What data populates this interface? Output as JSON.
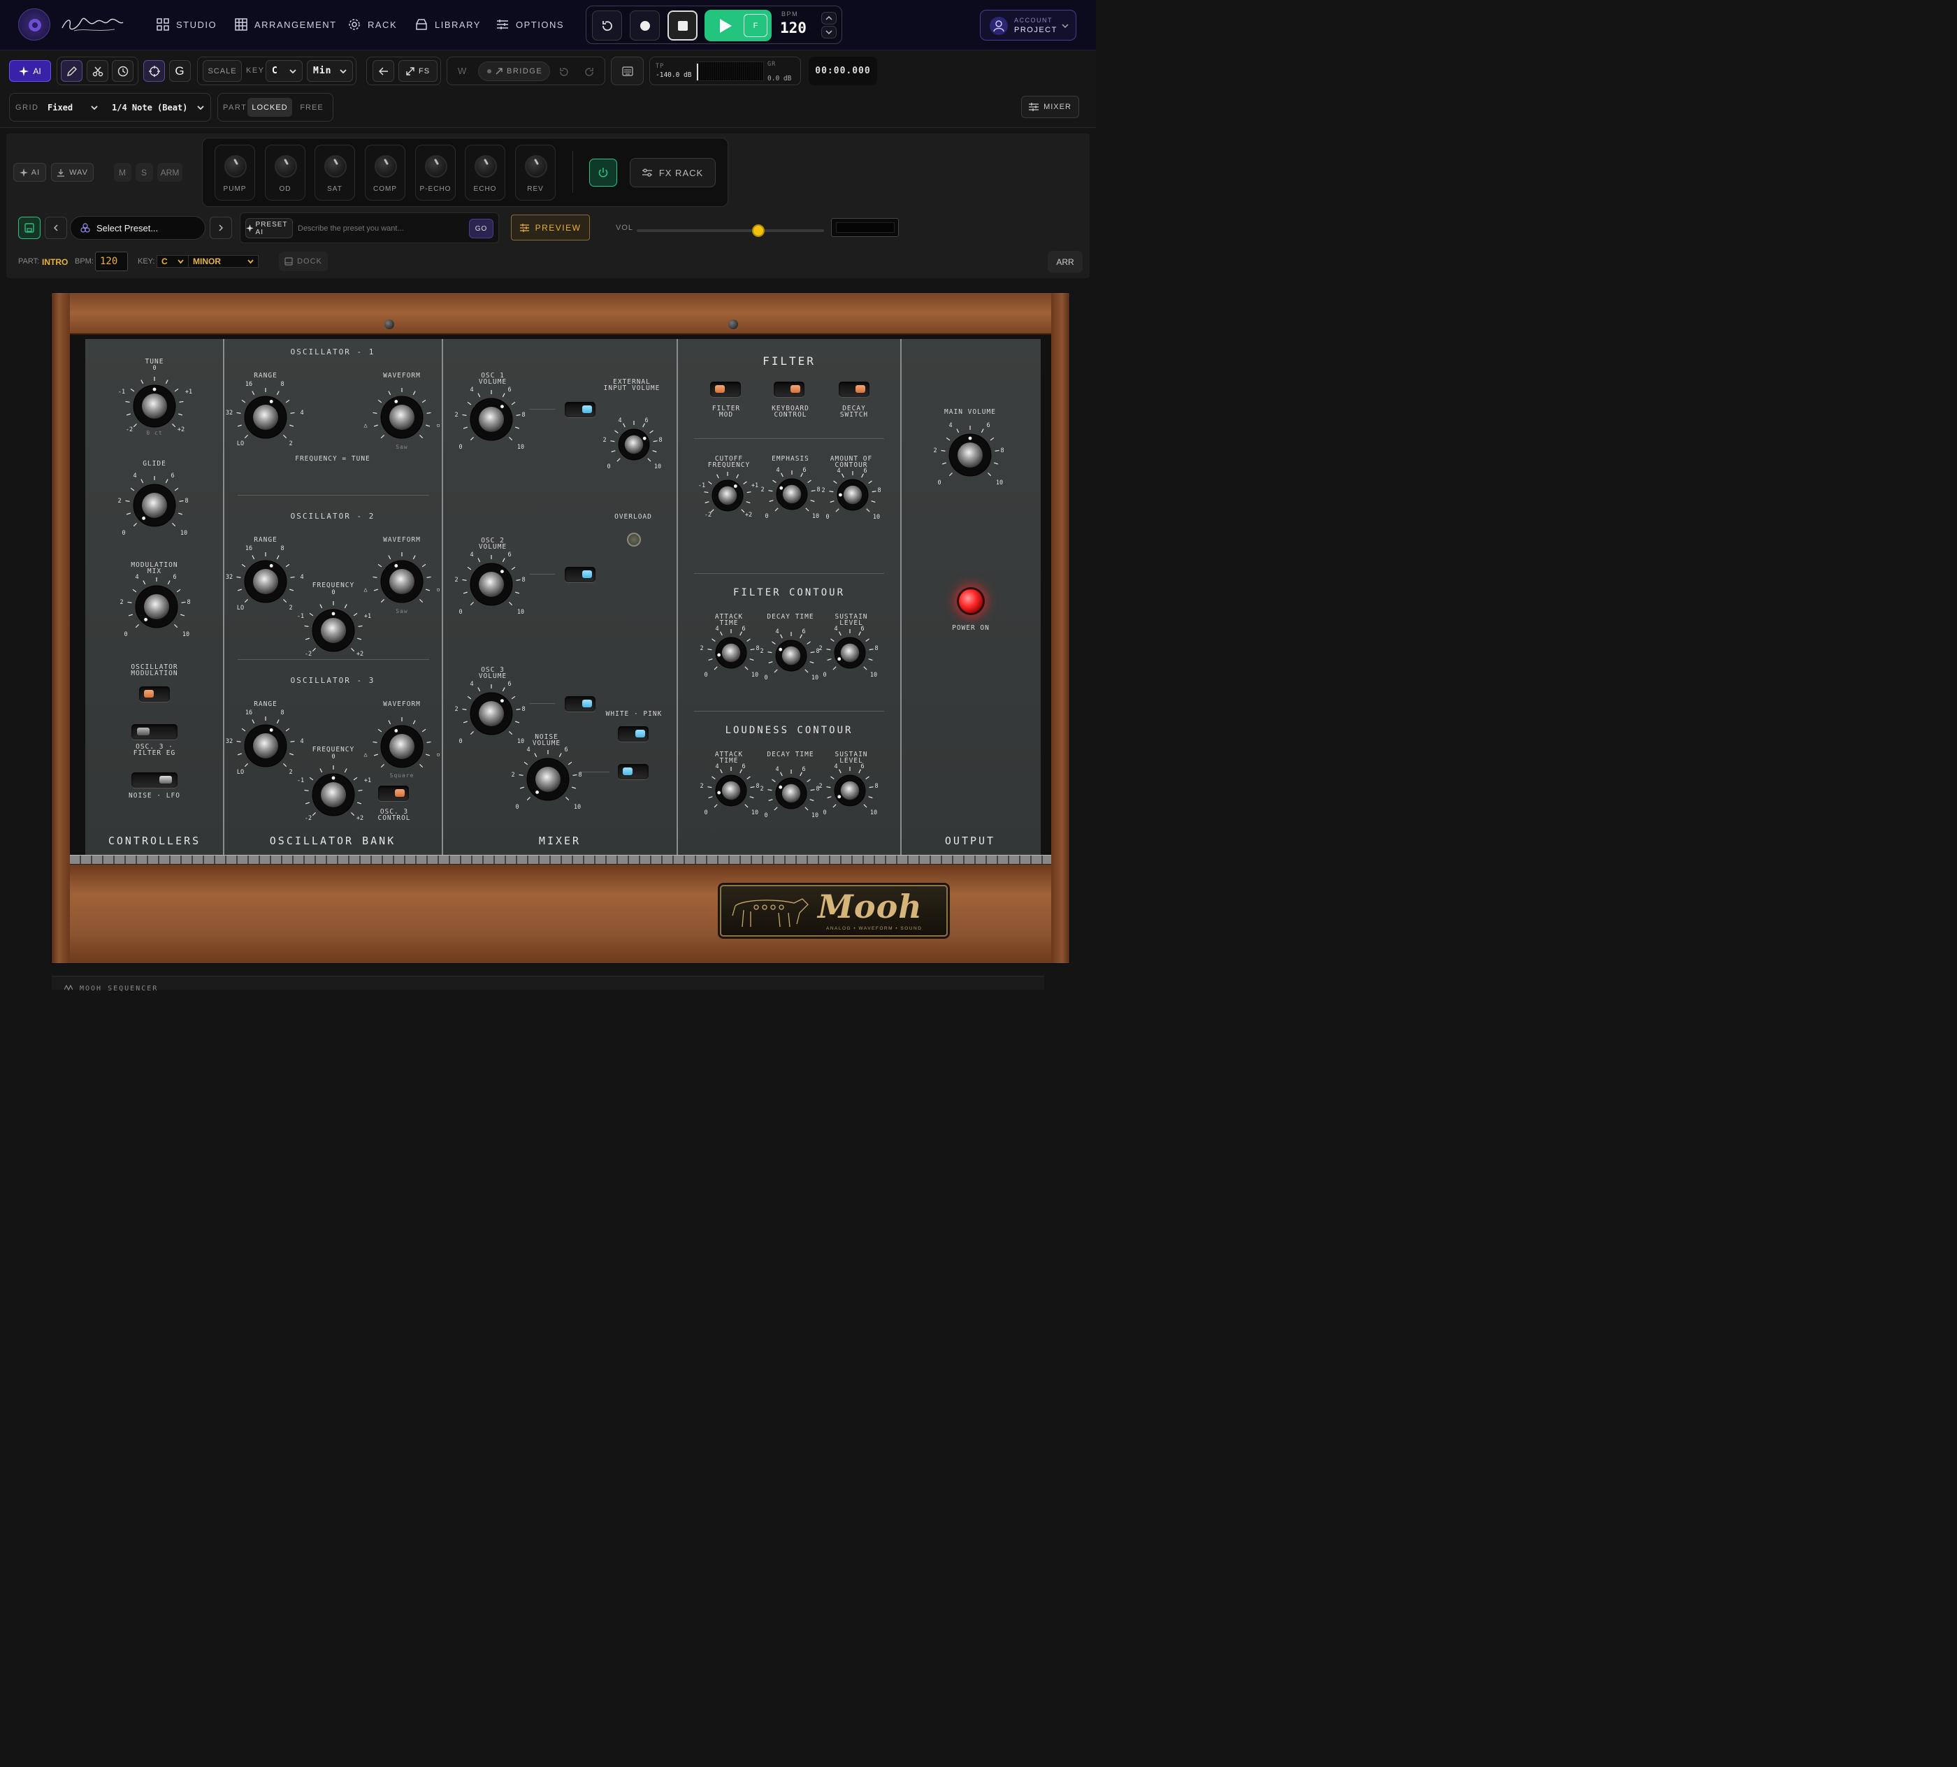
{
  "nav": {
    "tabs": [
      {
        "label": "STUDIO",
        "icon": "grid-icon"
      },
      {
        "label": "ARRANGEMENT",
        "icon": "table-icon"
      },
      {
        "label": "RACK",
        "icon": "gear-icon"
      },
      {
        "label": "LIBRARY",
        "icon": "box-icon"
      },
      {
        "label": "OPTIONS",
        "icon": "sliders-icon"
      }
    ],
    "transport": {
      "follow": "F",
      "bpm_label": "BPM",
      "bpm": "120"
    },
    "account": {
      "label": "ACCOUNT",
      "project": "PROJECT"
    }
  },
  "toolbar": {
    "ai": "AI",
    "g": "G",
    "scale": "SCALE",
    "key_label": "KEY",
    "key": "C",
    "mode": "Min",
    "fs": "FS",
    "w": "W",
    "bridge": "BRIDGE",
    "tp_label": "TP",
    "tp_value": "-140.0 dB",
    "gr_label": "GR",
    "gr_value": "0.0 dB",
    "time": "00:00.000"
  },
  "grid_row": {
    "grid_label": "GRID",
    "grid_value": "Fixed",
    "note_value": "1/4 Note (Beat)",
    "part_label": "PART",
    "locked": "LOCKED",
    "free": "FREE",
    "mixer": "MIXER"
  },
  "track": {
    "ai": "AI",
    "wav": "WAV",
    "m": "M",
    "s": "S",
    "arm": "ARM",
    "fx": [
      "PUMP",
      "OD",
      "SAT",
      "COMP",
      "P-ECHO",
      "ECHO",
      "REV"
    ],
    "fx_rack": "FX RACK",
    "preset_placeholder": "Select Preset...",
    "preset_ai": "PRESET AI",
    "prompt_placeholder": "Describe the preset you want...",
    "go": "GO",
    "preview": "PREVIEW",
    "vol": "VOL",
    "vol_level": 0.65,
    "part_label": "PART:",
    "part_value": "INTRO",
    "bpm_label": "BPM:",
    "bpm_value": "120",
    "key_label": "KEY:",
    "key_value": "C",
    "mode_value": "MINOR",
    "dock": "DOCK",
    "arr": "ARR"
  },
  "synth": {
    "controllers": {
      "title": "CONTROLLERS",
      "tune": "TUNE",
      "glide": "GLIDE",
      "mod_mix": "MODULATION MIX",
      "osc_mod": "OSCILLATOR MODULATION",
      "osc3_filter": "OSC. 3 · FILTER EG",
      "noise_lfo": "NOISE · LFO",
      "ct": "0 ct"
    },
    "osc": {
      "title": "OSCILLATOR BANK",
      "osc1": "OSCILLATOR - 1",
      "osc2": "OSCILLATOR - 2",
      "osc3": "OSCILLATOR - 3",
      "range": "RANGE",
      "waveform": "WAVEFORM",
      "freq_tune": "FREQUENCY = TUNE",
      "frequency": "FREQUENCY",
      "saw": "Saw",
      "square": "Square",
      "osc3_ctrl": "OSC. 3 CONTROL"
    },
    "mixer": {
      "title": "MIXER",
      "osc1_vol": "OSC 1 VOLUME",
      "osc2_vol": "OSC 2 VOLUME",
      "osc3_vol": "OSC 3 VOLUME",
      "ext": "EXTERNAL INPUT VOLUME",
      "overload": "OVERLOAD",
      "white_pink": "WHITE · PINK",
      "noise_vol": "NOISE VOLUME"
    },
    "filter": {
      "title": "FILTER",
      "filter_mod": "FILTER MOD",
      "kbd": "KEYBOARD CONTROL",
      "decay_sw": "DECAY SWITCH",
      "cutoff": "CUTOFF FREQUENCY",
      "emphasis": "EMPHASIS",
      "amount": "AMOUNT OF CONTOUR",
      "fc_title": "FILTER CONTOUR",
      "lc_title": "LOUDNESS CONTOUR",
      "attack": "ATTACK TIME",
      "decay": "DECAY TIME",
      "sustain": "SUSTAIN LEVEL"
    },
    "output": {
      "title": "OUTPUT",
      "main_vol": "MAIN VOLUME",
      "power": "POWER ON"
    },
    "brand": {
      "name": "Mooh",
      "tagline": "ANALOG • WAVEFORM • SOUND"
    }
  },
  "footer": {
    "sequencer": "MOOH SEQUENCER"
  },
  "colors": {
    "accent_green": "#22c47e",
    "accent_purple": "#6a4cff",
    "gold": "#e7b23d",
    "led_red": "#ff2a2a"
  }
}
